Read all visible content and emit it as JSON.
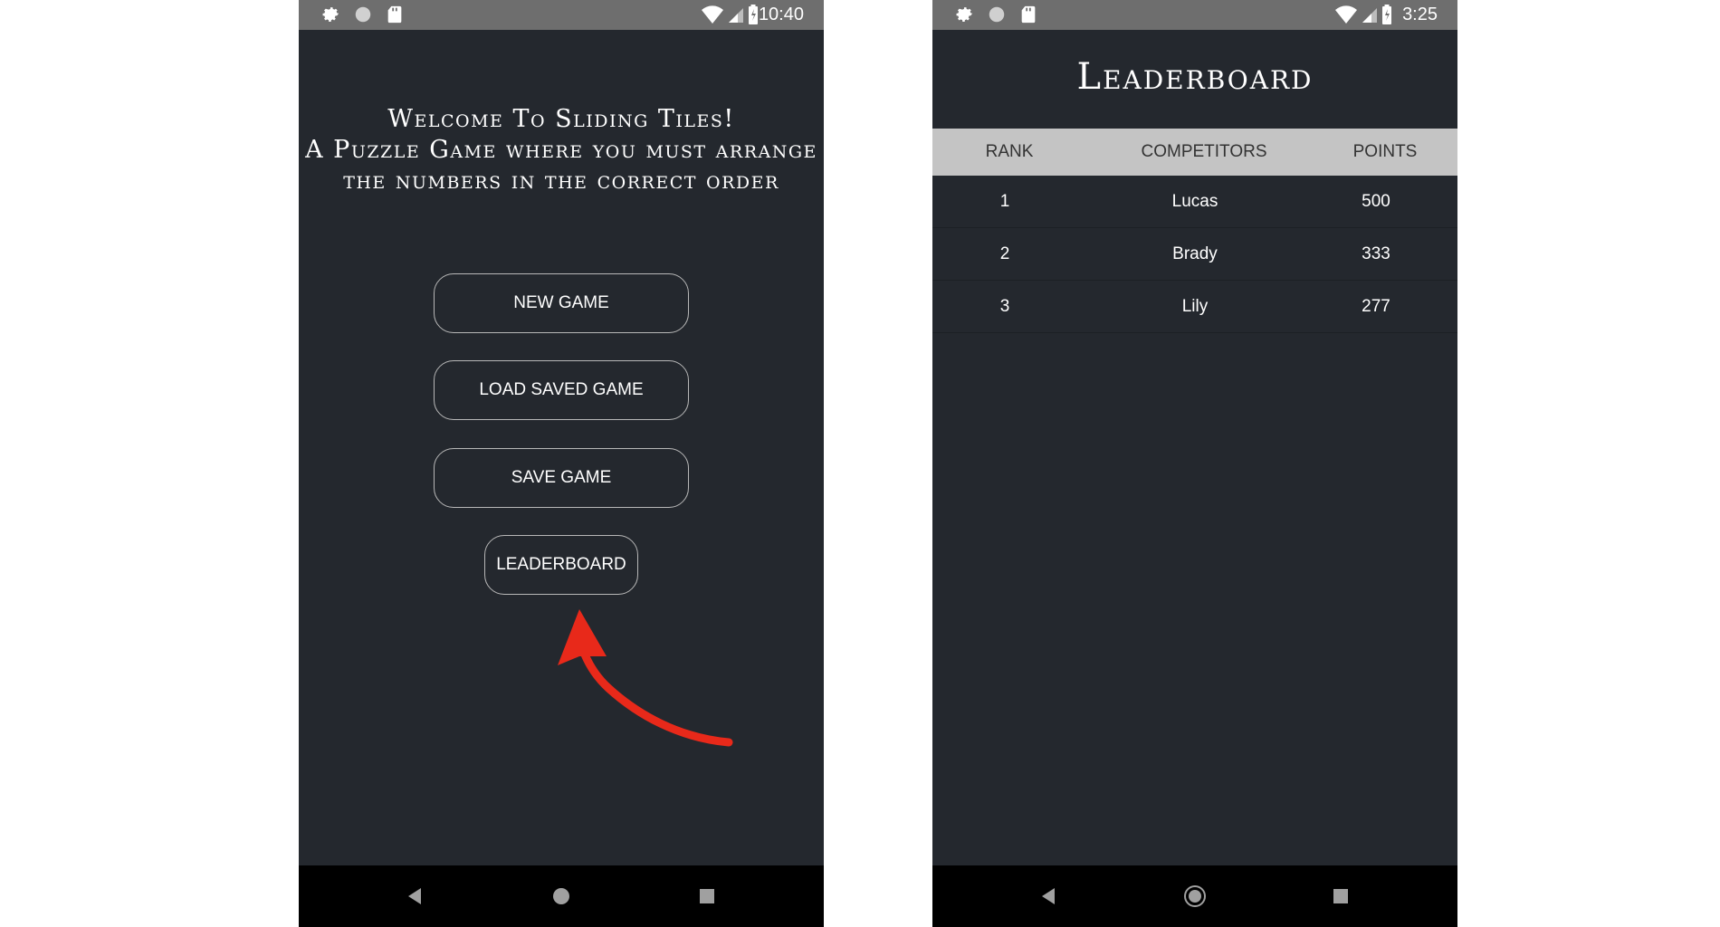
{
  "left_screen": {
    "status": {
      "time": "10:40"
    },
    "welcome_lines": [
      "Welcome To Sliding Tiles!",
      "A Puzzle Game where you must arrange",
      "the numbers in the correct order"
    ],
    "buttons": {
      "new_game": "NEW GAME",
      "load_saved_game": "LOAD SAVED GAME",
      "save_game": "SAVE GAME",
      "leaderboard": "LEADERBOARD"
    },
    "annotation_arrow_color": "#e8291a"
  },
  "right_screen": {
    "status": {
      "time": "3:25"
    },
    "title": "Leaderboard",
    "columns": {
      "rank": "RANK",
      "competitors": "COMPETITORS",
      "points": "POINTS"
    },
    "rows": [
      {
        "rank": "1",
        "name": "Lucas",
        "points": "500"
      },
      {
        "rank": "2",
        "name": "Brady",
        "points": "333"
      },
      {
        "rank": "3",
        "name": "Lily",
        "points": "277"
      }
    ]
  },
  "colors": {
    "app_background": "#24282e",
    "status_bar": "#6e6e6e",
    "nav_bar": "#000000",
    "table_header": "#c4c4c4"
  },
  "icons": [
    "gear-icon",
    "circle-icon",
    "sd-card-icon",
    "wifi-icon",
    "signal-icon",
    "battery-icon",
    "back-icon",
    "home-icon",
    "recents-icon",
    "arrow-annotation-icon"
  ]
}
